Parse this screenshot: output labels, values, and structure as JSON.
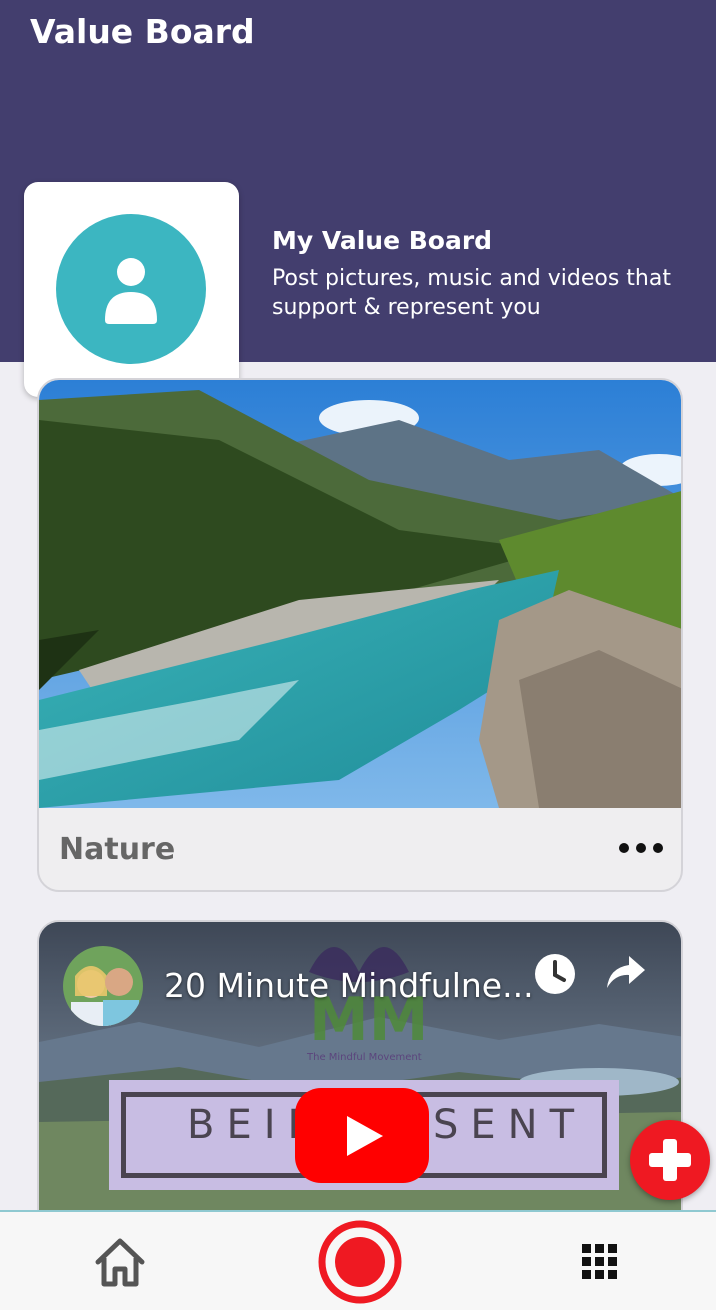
{
  "header": {
    "app_title": "Value Board",
    "background_color": "#433e6e"
  },
  "profile": {
    "avatar_icon": "user-icon",
    "avatar_color": "#3cb6c1",
    "board_title": "My Value Board",
    "board_description": "Post pictures, music and videos that support & represent you"
  },
  "posts": [
    {
      "type": "image",
      "label": "Nature",
      "image_subject": "mountain river valley",
      "more_icon": "more-horizontal-icon"
    },
    {
      "type": "video",
      "video_title": "20 Minute Mindfulne...",
      "banner_text_left": "BEIN",
      "banner_text_right": "SENT",
      "logo_caption": "The Mindful Movement",
      "play_icon": "youtube-play-icon",
      "watch_later_icon": "clock-icon",
      "share_icon": "share-arrow-icon"
    }
  ],
  "fab": {
    "icon": "plus-icon",
    "color": "#ef1922"
  },
  "bottom_nav": {
    "items": [
      {
        "icon": "home-icon"
      },
      {
        "icon": "record-icon",
        "color": "#ef1922"
      },
      {
        "icon": "apps-grid-icon"
      }
    ]
  }
}
